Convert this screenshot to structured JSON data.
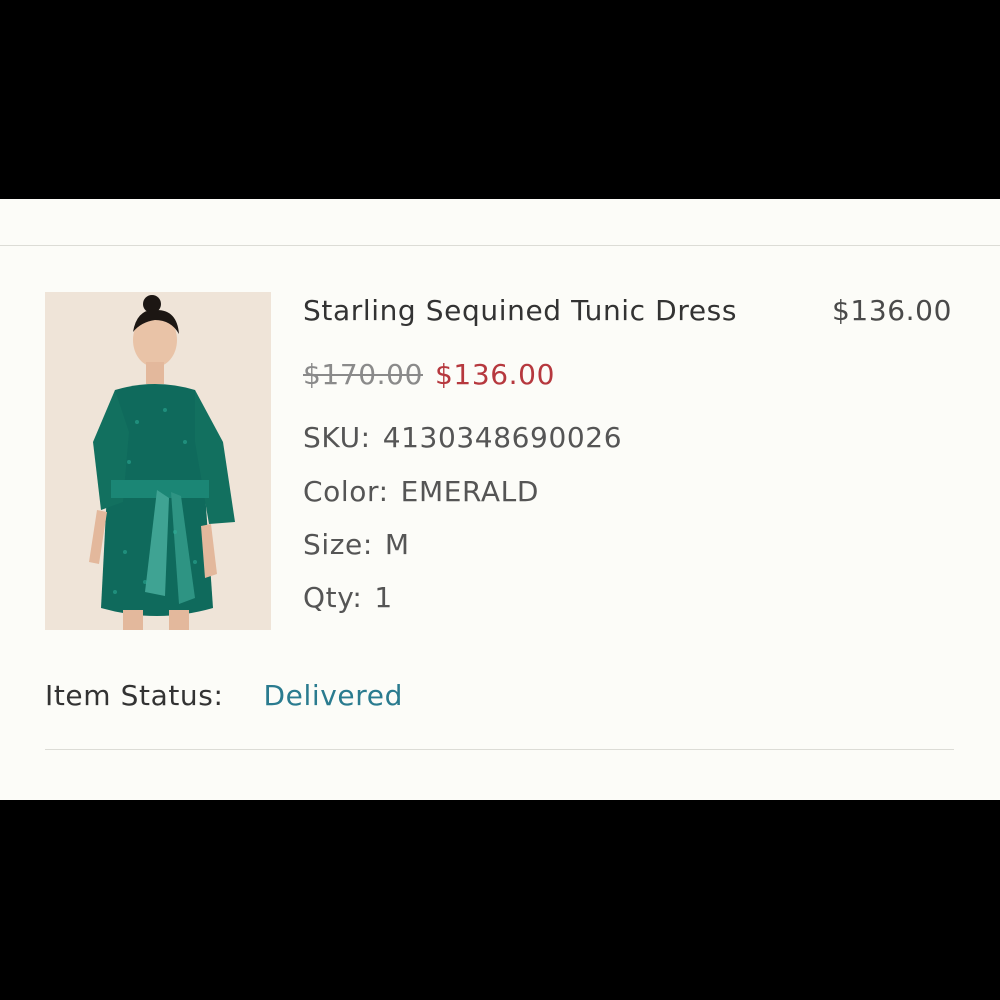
{
  "item": {
    "name": "Starling Sequined Tunic Dress",
    "line_price": "$136.00",
    "original_price": "$170.00",
    "sale_price": "$136.00",
    "sku_label": "SKU:",
    "sku_value": "4130348690026",
    "color_label": "Color:",
    "color_value": "EMERALD",
    "size_label": "Size:",
    "size_value": "M",
    "qty_label": "Qty:",
    "qty_value": "1",
    "image_icon": "product-photo-emerald-dress"
  },
  "status": {
    "label": "Item Status:",
    "value": "Delivered"
  },
  "colors": {
    "sale_price": "#b6383e",
    "status_value": "#2a7b8f",
    "panel_background": "#fcfcf8"
  }
}
